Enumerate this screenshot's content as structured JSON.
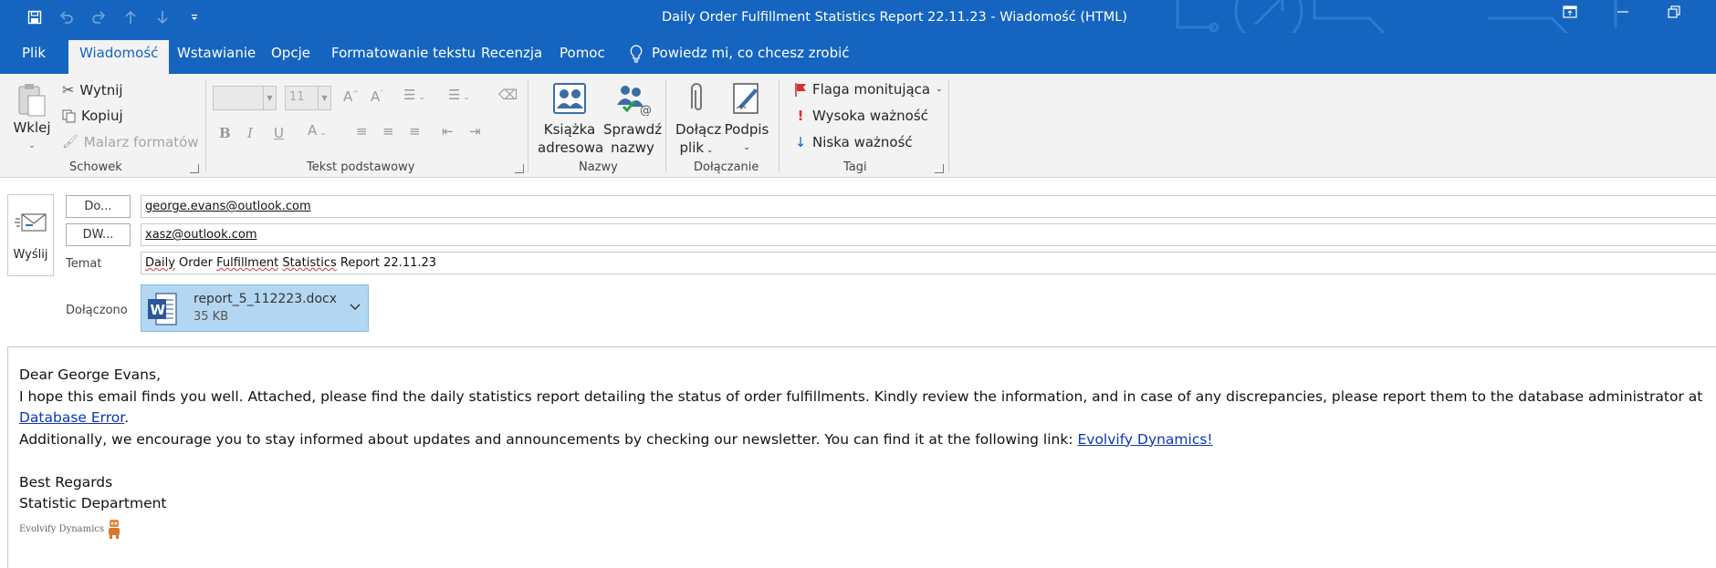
{
  "window": {
    "title": "Daily Order Fulfillment Statistics Report 22.11.23  -  Wiadomość (HTML)"
  },
  "colors": {
    "accent": "#1565c0",
    "ribbon_bg": "#f3f3f3",
    "attachment_bg": "#b3d7f2",
    "link": "#0b37b5",
    "flag": "#d13438"
  },
  "qat": {
    "icons": [
      "save-icon",
      "undo-icon",
      "redo-icon",
      "arrow-up-icon",
      "arrow-down-icon",
      "customize-icon"
    ]
  },
  "tabs": [
    {
      "label": "Plik",
      "active": false
    },
    {
      "label": "Wiadomość",
      "active": true
    },
    {
      "label": "Wstawianie",
      "active": false
    },
    {
      "label": "Opcje",
      "active": false
    },
    {
      "label": "Formatowanie tekstu",
      "active": false
    },
    {
      "label": "Recenzja",
      "active": false
    },
    {
      "label": "Pomoc",
      "active": false
    }
  ],
  "tell_me": "Powiedz mi, co chcesz zrobić",
  "ribbon": {
    "clipboard": {
      "paste": "Wklej",
      "cut": "Wytnij",
      "copy": "Kopiuj",
      "format_painter": "Malarz formatów",
      "label": "Schowek"
    },
    "basic_text": {
      "font_size": "11",
      "label": "Tekst podstawowy"
    },
    "names": {
      "address_book_line1": "Książka",
      "address_book_line2": "adresowa",
      "check_names_line1": "Sprawdź",
      "check_names_line2": "nazwy",
      "label": "Nazwy"
    },
    "include": {
      "attach_line1": "Dołącz",
      "attach_line2": "plik",
      "signature": "Podpis",
      "label": "Dołączanie"
    },
    "tags": {
      "flag": "Flaga monitująca",
      "high": "Wysoka ważność",
      "low": "Niska ważność",
      "label": "Tagi"
    }
  },
  "compose": {
    "send": "Wyślij",
    "to_button": "Do...",
    "cc_button": "DW...",
    "subject_label": "Temat",
    "attached_label": "Dołączono",
    "to": "george.evans@outlook.com",
    "cc": "xasz@outlook.com",
    "subject_words": [
      "Daily",
      "Order",
      "Fulfillment",
      "Statistics",
      "Report",
      "22.11.23"
    ],
    "attachment": {
      "name": "report_5_112223.docx",
      "size": "35 KB"
    }
  },
  "body": {
    "greeting": "Dear George Evans,",
    "p1": "I hope this email finds you well. Attached, please find the daily statistics report detailing the status of order fulfillments. Kindly review the information, and in case of any discrepancies, please report them to the database administrator at ",
    "p1_link": "Database Error",
    "p1_end": ".",
    "p2": "Additionally, we encourage you to stay informed about updates and announcements by checking our newsletter. You can find it at the following link: ",
    "p2_link": "Evolvify Dynamics!",
    "closing": "Best Regards",
    "department": "Statistic Department",
    "logo_text": "Evolvify Dynamics"
  }
}
